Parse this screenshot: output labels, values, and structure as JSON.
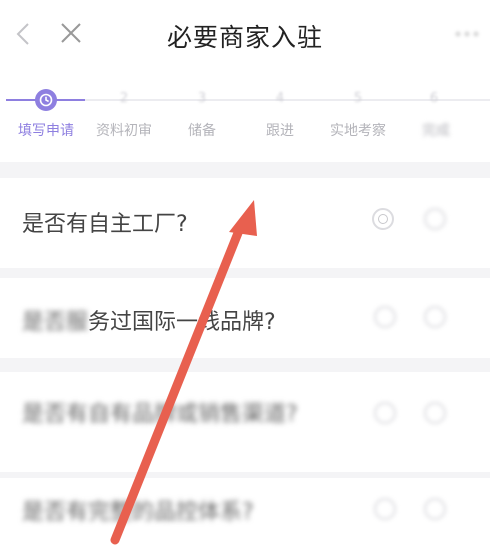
{
  "header": {
    "title": "必要商家入驻"
  },
  "steps": [
    {
      "number": "",
      "label": "填写申请",
      "active": true
    },
    {
      "number": "2",
      "label": "资料初审",
      "active": false
    },
    {
      "number": "3",
      "label": "储备",
      "active": false
    },
    {
      "number": "4",
      "label": "跟进",
      "active": false
    },
    {
      "number": "5",
      "label": "实地考察",
      "active": false
    },
    {
      "number": "6",
      "label": "完成",
      "active": false
    }
  ],
  "questions": [
    {
      "text": "是否有自主工厂?"
    },
    {
      "text": "是否服务过国际一线品牌?"
    },
    {
      "text": "是否有自有品牌或销售渠道?"
    },
    {
      "text": "是否有完整的品控体系?"
    }
  ],
  "colors": {
    "accent": "#8e7fe0",
    "annotation_arrow": "#e8604f",
    "background": "#f4f4f6"
  }
}
